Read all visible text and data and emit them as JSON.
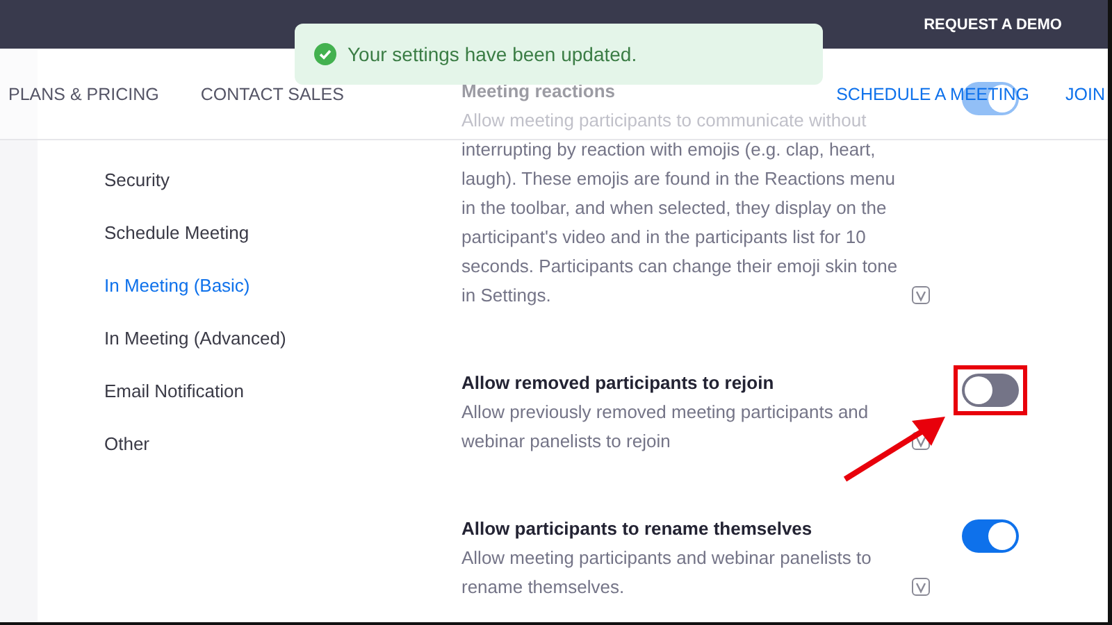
{
  "top_bar": {
    "button": "REQUEST A DEMO"
  },
  "toast": {
    "message": "Your settings have been updated."
  },
  "nav": {
    "links": [
      "PLANS & PRICING",
      "CONTACT SALES"
    ],
    "actions": [
      "SCHEDULE A MEETING",
      "JOIN"
    ]
  },
  "sidebar": {
    "items": [
      {
        "label": "Security",
        "selected": false
      },
      {
        "label": "Schedule Meeting",
        "selected": false
      },
      {
        "label": "In Meeting (Basic)",
        "selected": true
      },
      {
        "label": "In Meeting (Advanced)",
        "selected": false
      },
      {
        "label": "Email Notification",
        "selected": false
      },
      {
        "label": "Other",
        "selected": false
      }
    ]
  },
  "settings": [
    {
      "title": "Meeting reactions",
      "description": "Allow meeting participants to communicate without interrupting by reaction with emojis (e.g. clap, heart, laugh). These emojis are found in the Reactions menu in the toolbar, and when selected, they display on the participant's video and in the participants list for 10 seconds. Participants can change their emoji skin tone in Settings.",
      "on": true,
      "highlighted": false
    },
    {
      "title": "Allow removed participants to rejoin",
      "description": "Allow previously removed meeting participants and webinar panelists to rejoin",
      "on": false,
      "highlighted": true
    },
    {
      "title": "Allow participants to rename themselves",
      "description": "Allow meeting participants and webinar panelists to rename themselves.",
      "on": true,
      "highlighted": false
    }
  ]
}
